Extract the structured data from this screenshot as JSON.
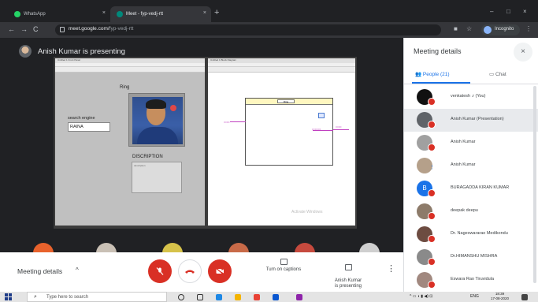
{
  "browser": {
    "tabs": [
      {
        "label": "WhatsApp",
        "active": false
      },
      {
        "label": "Meet - fyp-vedj-rtt",
        "active": true
      }
    ],
    "new_tab": "+",
    "close_glyph": "×",
    "url_host": "meet.google.com/",
    "url_path": "fyp-vedj-rtt",
    "profile_label": "Incognito",
    "window_controls": [
      "–",
      "□",
      "×"
    ],
    "nav": {
      "back": "←",
      "forward": "→",
      "reload": "C"
    }
  },
  "stage": {
    "presenter_label": "Anish Kumar is presenting"
  },
  "shared_screen": {
    "ring_label": "Ring",
    "search_label": "search engine",
    "search_value": "RAINA",
    "description_label": "DISCRIPTION",
    "description_value": "description",
    "front_panel_title": "Untitled 1 Front Panel",
    "block_diagram_title": "Untitled 1 Block Diagram",
    "block_tag": "Ring",
    "watermark": "Activate Windows"
  },
  "call_bar": {
    "meeting_details": "Meeting details",
    "captions_label": "Turn on captions",
    "presenting_label": "Anish Kumar\nis presenting",
    "more": "⋮"
  },
  "panel": {
    "title": "Meeting details",
    "close": "×",
    "people_tab": "People (21)",
    "chat_tab": "Chat",
    "participants": [
      {
        "name": "venkatesh .r (You)",
        "color": "#111111",
        "muted": true
      },
      {
        "name": "Anish Kumar (Presentation)",
        "color": "#5f6368",
        "muted": true,
        "highlight": true
      },
      {
        "name": "Anish Kumar",
        "color": "#a0a0a0",
        "muted": true
      },
      {
        "name": "Anish Kumar",
        "color": "#b5a08a",
        "muted": false
      },
      {
        "name": "BURAGADDA KIRAN KUMAR",
        "color": "#1a73e8",
        "muted": true,
        "initial": "B"
      },
      {
        "name": "deepak deepu",
        "color": "#8d7b6a",
        "muted": true
      },
      {
        "name": "Dr. Nageswararao Medikondu",
        "color": "#6d4c41",
        "muted": true
      },
      {
        "name": "Dr.HIMANSHU MISHRA",
        "color": "#8a8a8a",
        "muted": true
      },
      {
        "name": "Eswara Rao Tiruvidula",
        "color": "#a1887f",
        "muted": true
      }
    ]
  },
  "taskbar": {
    "search_placeholder": "Type here to search",
    "tray": "ENG",
    "time": "18:39",
    "date": "17-08-2020"
  }
}
